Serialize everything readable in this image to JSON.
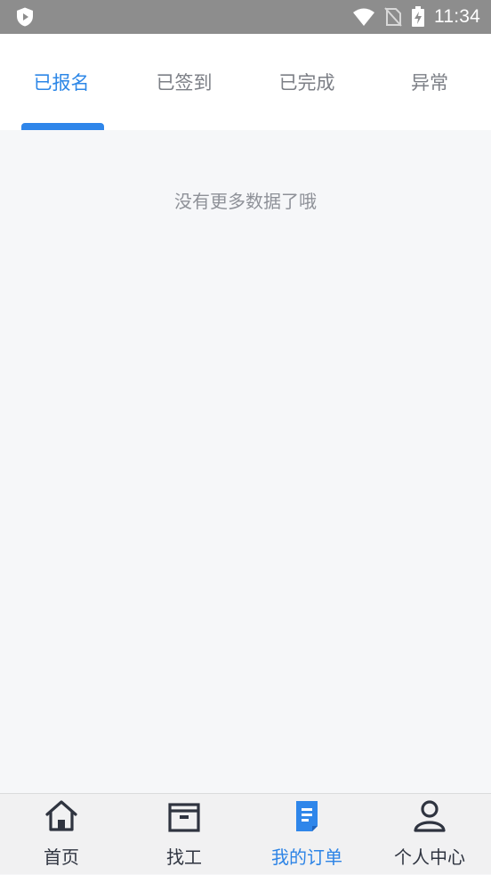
{
  "status_bar": {
    "time": "11:34",
    "icons": [
      "app-shield-icon",
      "wifi-icon",
      "no-sim-icon",
      "battery-charging-icon"
    ]
  },
  "tabs": [
    {
      "label": "已报名",
      "active": true
    },
    {
      "label": "已签到",
      "active": false
    },
    {
      "label": "已完成",
      "active": false
    },
    {
      "label": "异常",
      "active": false
    }
  ],
  "content": {
    "empty_text": "没有更多数据了哦"
  },
  "bottom_nav": [
    {
      "label": "首页",
      "icon": "home-icon",
      "active": false
    },
    {
      "label": "找工",
      "icon": "briefcase-icon",
      "active": false
    },
    {
      "label": "我的订单",
      "icon": "order-document-icon",
      "active": true
    },
    {
      "label": "个人中心",
      "icon": "user-profile-icon",
      "active": false
    }
  ],
  "colors": {
    "accent": "#2F86EA",
    "inactive_text": "#7C7F86",
    "background": "#F6F7F9",
    "nav_background": "#F1F1F2"
  }
}
